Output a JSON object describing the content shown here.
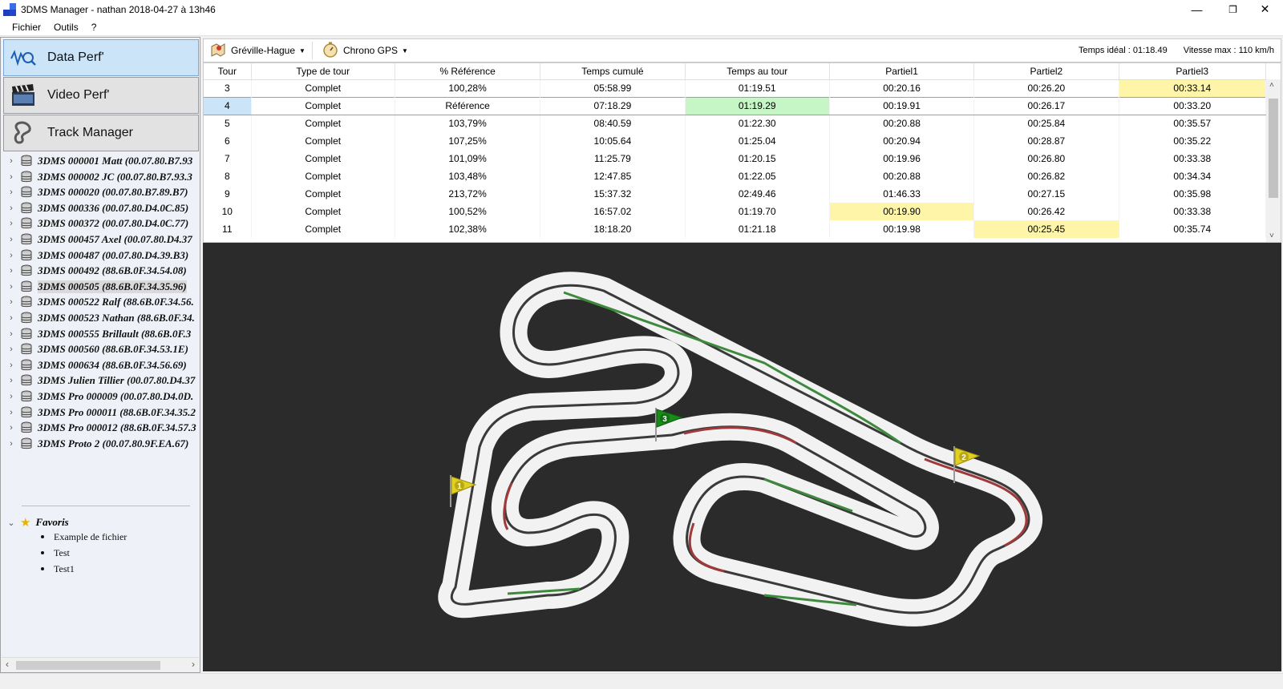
{
  "window": {
    "title": "3DMS Manager - nathan 2018-04-27 à 13h46",
    "minimize": "—",
    "restore": "❐",
    "close": "✕"
  },
  "menubar": {
    "items": [
      "Fichier",
      "Outils",
      "?"
    ]
  },
  "nav": {
    "data_perf": "Data Perf'",
    "video_perf": "Video Perf'",
    "track_manager": "Track Manager"
  },
  "tree": {
    "devices": [
      "3DMS 000001 Matt (00.07.80.B7.93",
      "3DMS 000002 JC (00.07.80.B7.93.3",
      "3DMS 000020 (00.07.80.B7.89.B7)",
      "3DMS 000336 (00.07.80.D4.0C.85)",
      "3DMS 000372 (00.07.80.D4.0C.77)",
      "3DMS 000457 Axel (00.07.80.D4.37",
      "3DMS 000487 (00.07.80.D4.39.B3)",
      "3DMS 000492 (88.6B.0F.34.54.08)",
      "3DMS 000505 (88.6B.0F.34.35.96)",
      "3DMS 000522 Ralf (88.6B.0F.34.56.",
      "3DMS 000523 Nathan (88.6B.0F.34.",
      "3DMS 000555 Brillault (88.6B.0F.3",
      "3DMS 000560 (88.6B.0F.34.53.1E)",
      "3DMS 000634 (88.6B.0F.34.56.69)",
      "3DMS Julien Tillier (00.07.80.D4.37",
      "3DMS Pro 000009 (00.07.80.D4.0D.",
      "3DMS Pro 000011 (88.6B.0F.34.35.2",
      "3DMS Pro 000012 (88.6B.0F.34.57.3",
      "3DMS Proto 2 (00.07.80.9F.EA.67)"
    ],
    "selected_index": 8,
    "favorites_label": "Favoris",
    "favorites": [
      "Example de fichier",
      "Test",
      "Test1"
    ]
  },
  "toolbar": {
    "track": "Gréville-Hague",
    "chrono": "Chrono GPS",
    "ideal_time": "Temps idéal : 01:18.49",
    "max_speed": "Vitesse max : 110 km/h"
  },
  "table": {
    "headers": [
      "Tour",
      "Type de tour",
      "% Référence",
      "Temps cumulé",
      "Temps au tour",
      "Partiel1",
      "Partiel2",
      "Partiel3"
    ],
    "rows": [
      [
        "3",
        "Complet",
        "100,28%",
        "05:58.99",
        "01:19.51",
        "00:20.16",
        "00:26.20",
        "00:33.14"
      ],
      [
        "4",
        "Complet",
        "Référence",
        "07:18.29",
        "01:19.29",
        "00:19.91",
        "00:26.17",
        "00:33.20"
      ],
      [
        "5",
        "Complet",
        "103,79%",
        "08:40.59",
        "01:22.30",
        "00:20.88",
        "00:25.84",
        "00:35.57"
      ],
      [
        "6",
        "Complet",
        "107,25%",
        "10:05.64",
        "01:25.04",
        "00:20.94",
        "00:28.87",
        "00:35.22"
      ],
      [
        "7",
        "Complet",
        "101,09%",
        "11:25.79",
        "01:20.15",
        "00:19.96",
        "00:26.80",
        "00:33.38"
      ],
      [
        "8",
        "Complet",
        "103,48%",
        "12:47.85",
        "01:22.05",
        "00:20.88",
        "00:26.82",
        "00:34.34"
      ],
      [
        "9",
        "Complet",
        "213,72%",
        "15:37.32",
        "02:49.46",
        "01:46.33",
        "00:27.15",
        "00:35.98"
      ],
      [
        "10",
        "Complet",
        "100,52%",
        "16:57.02",
        "01:19.70",
        "00:19.90",
        "00:26.42",
        "00:33.38"
      ],
      [
        "11",
        "Complet",
        "102,38%",
        "18:18.20",
        "01:21.18",
        "00:19.98",
        "00:25.45",
        "00:35.74"
      ]
    ],
    "selected_row": 1,
    "highlights": [
      {
        "row": 0,
        "col": 7,
        "color": "#fff5a8"
      },
      {
        "row": 1,
        "col": 4,
        "color": "#c6f5c6"
      },
      {
        "row": 7,
        "col": 5,
        "color": "#fff5a8"
      },
      {
        "row": 8,
        "col": 6,
        "color": "#fff5a8"
      }
    ]
  },
  "map": {
    "flags": [
      {
        "label": "1",
        "color": "#e0d020"
      },
      {
        "label": "2",
        "color": "#e0d020"
      },
      {
        "label": "3",
        "color": "#1a8a1a"
      }
    ],
    "background": "#2b2b2b",
    "track_color": "#f2f2f2"
  }
}
